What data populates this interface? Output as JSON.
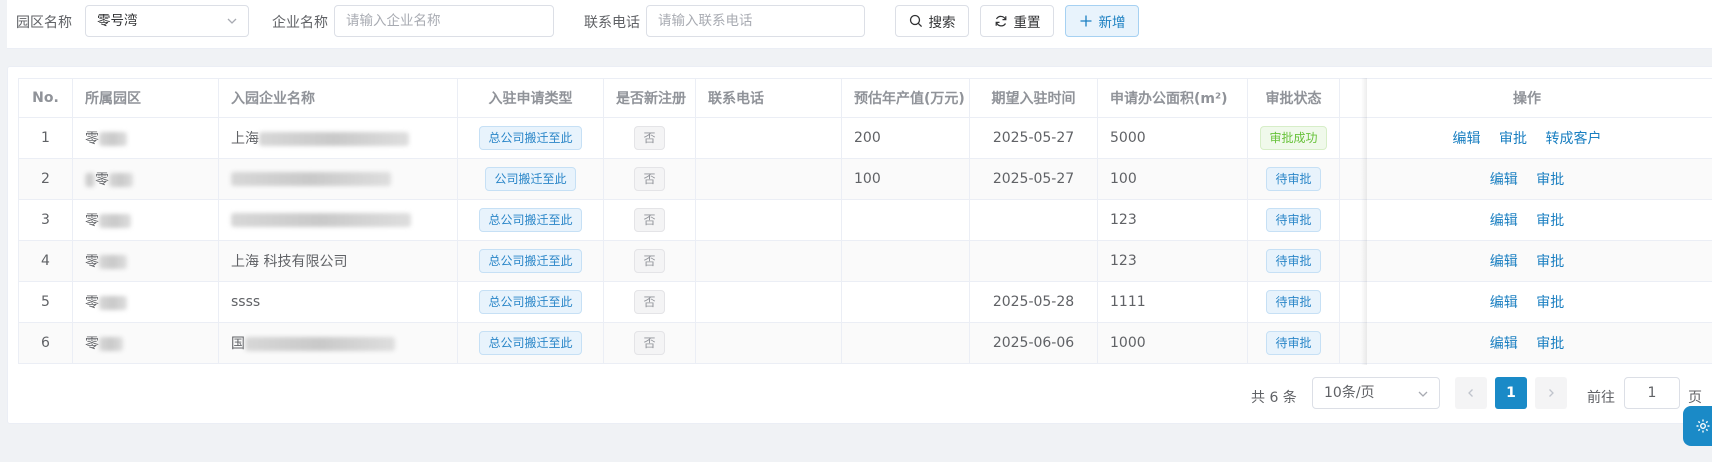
{
  "filters": {
    "park_label": "园区名称",
    "park_value": "零号湾",
    "company_label": "企业名称",
    "company_placeholder": "请输入企业名称",
    "phone_label": "联系电话",
    "phone_placeholder": "请输入联系电话",
    "search_label": "搜索",
    "reset_label": "重置",
    "add_label": "新增"
  },
  "table": {
    "headers": [
      "No.",
      "所属园区",
      "入园企业名称",
      "入驻申请类型",
      "是否新注册",
      "联系电话",
      "预估年产值(万元)",
      "期望入驻时间",
      "申请办公面积(m²)",
      "审批状态",
      "操作"
    ],
    "rows": [
      {
        "no": "1",
        "park": "零",
        "company": "上海",
        "type": "总公司搬迁至此",
        "new_reg": "否",
        "phone": "",
        "output": "200",
        "date": "2025-05-27",
        "area": "5000",
        "status": "审批成功",
        "ops": [
          "编辑",
          "审批",
          "转成客户"
        ]
      },
      {
        "no": "2",
        "park": "零",
        "company": "",
        "type": "公司搬迁至此",
        "new_reg": "否",
        "phone": "",
        "output": "100",
        "date": "2025-05-27",
        "area": "100",
        "status": "待审批",
        "ops": [
          "编辑",
          "审批"
        ]
      },
      {
        "no": "3",
        "park": "零",
        "company": "",
        "type": "总公司搬迁至此",
        "new_reg": "否",
        "phone": "",
        "output": "",
        "date": "",
        "area": "123",
        "status": "待审批",
        "ops": [
          "编辑",
          "审批"
        ]
      },
      {
        "no": "4",
        "park": "零",
        "company": "上海 科技有限公司",
        "type": "总公司搬迁至此",
        "new_reg": "否",
        "phone": "",
        "output": "",
        "date": "",
        "area": "123",
        "status": "待审批",
        "ops": [
          "编辑",
          "审批"
        ]
      },
      {
        "no": "5",
        "park": "零",
        "company": "ssss",
        "type": "总公司搬迁至此",
        "new_reg": "否",
        "phone": "",
        "output": "",
        "date": "2025-05-28",
        "area": "1111",
        "status": "待审批",
        "ops": [
          "编辑",
          "审批"
        ]
      },
      {
        "no": "6",
        "park": "零",
        "company": "国",
        "type": "总公司搬迁至此",
        "new_reg": "否",
        "phone": "",
        "output": "",
        "date": "2025-06-06",
        "area": "1000",
        "status": "待审批",
        "ops": [
          "编辑",
          "审批"
        ]
      }
    ]
  },
  "pagination": {
    "total": "共 6 条",
    "page_size": "10条/页",
    "current_page": "1",
    "goto_label": "前往",
    "goto_value": "1",
    "page_suffix": "页"
  },
  "colors": {
    "primary": "#1a8ac7",
    "link": "#1a7fc1",
    "success": "#67c23a"
  },
  "icons": [
    "search-icon",
    "refresh-icon",
    "plus-icon",
    "chevron-down-icon",
    "chevron-left-icon",
    "chevron-right-icon",
    "gear-icon"
  ]
}
